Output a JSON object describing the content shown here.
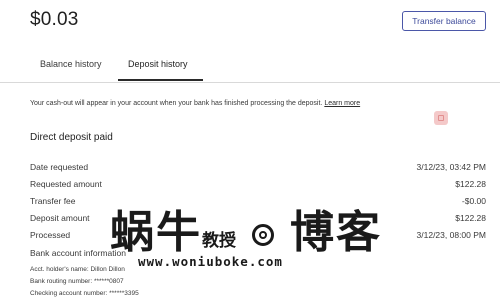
{
  "header": {
    "balance": "$0.03",
    "transfer_button": "Transfer balance"
  },
  "tabs": [
    {
      "label": "Balance history",
      "active": false
    },
    {
      "label": "Deposit history",
      "active": true
    }
  ],
  "notice": {
    "text": "Your cash-out will appear in your account when your bank has finished processing the deposit.",
    "link": "Learn more"
  },
  "section": {
    "title": "Direct deposit paid",
    "rows": [
      {
        "label": "Date requested",
        "value": "3/12/23, 03:42 PM"
      },
      {
        "label": "Requested amount",
        "value": "$122.28"
      },
      {
        "label": "Transfer fee",
        "value": "-$0.00"
      },
      {
        "label": "Deposit amount",
        "value": "$122.28"
      },
      {
        "label": "Processed",
        "value": "3/12/23, 08:00 PM"
      }
    ],
    "bank_title": "Bank account information",
    "bank_lines": [
      "Acct. holder's name: Dillon Dillon",
      "Bank routing number: ******0807",
      "Checking account number: ******3395"
    ]
  },
  "watermark": {
    "left": "蜗牛",
    "middle": "教授",
    "right": "博客",
    "url": "www.woniuboke.com"
  },
  "colors": {
    "accent": "#3d4a9a",
    "divider": "#d9d9d9",
    "icon_bg": "#f4c9c9"
  }
}
